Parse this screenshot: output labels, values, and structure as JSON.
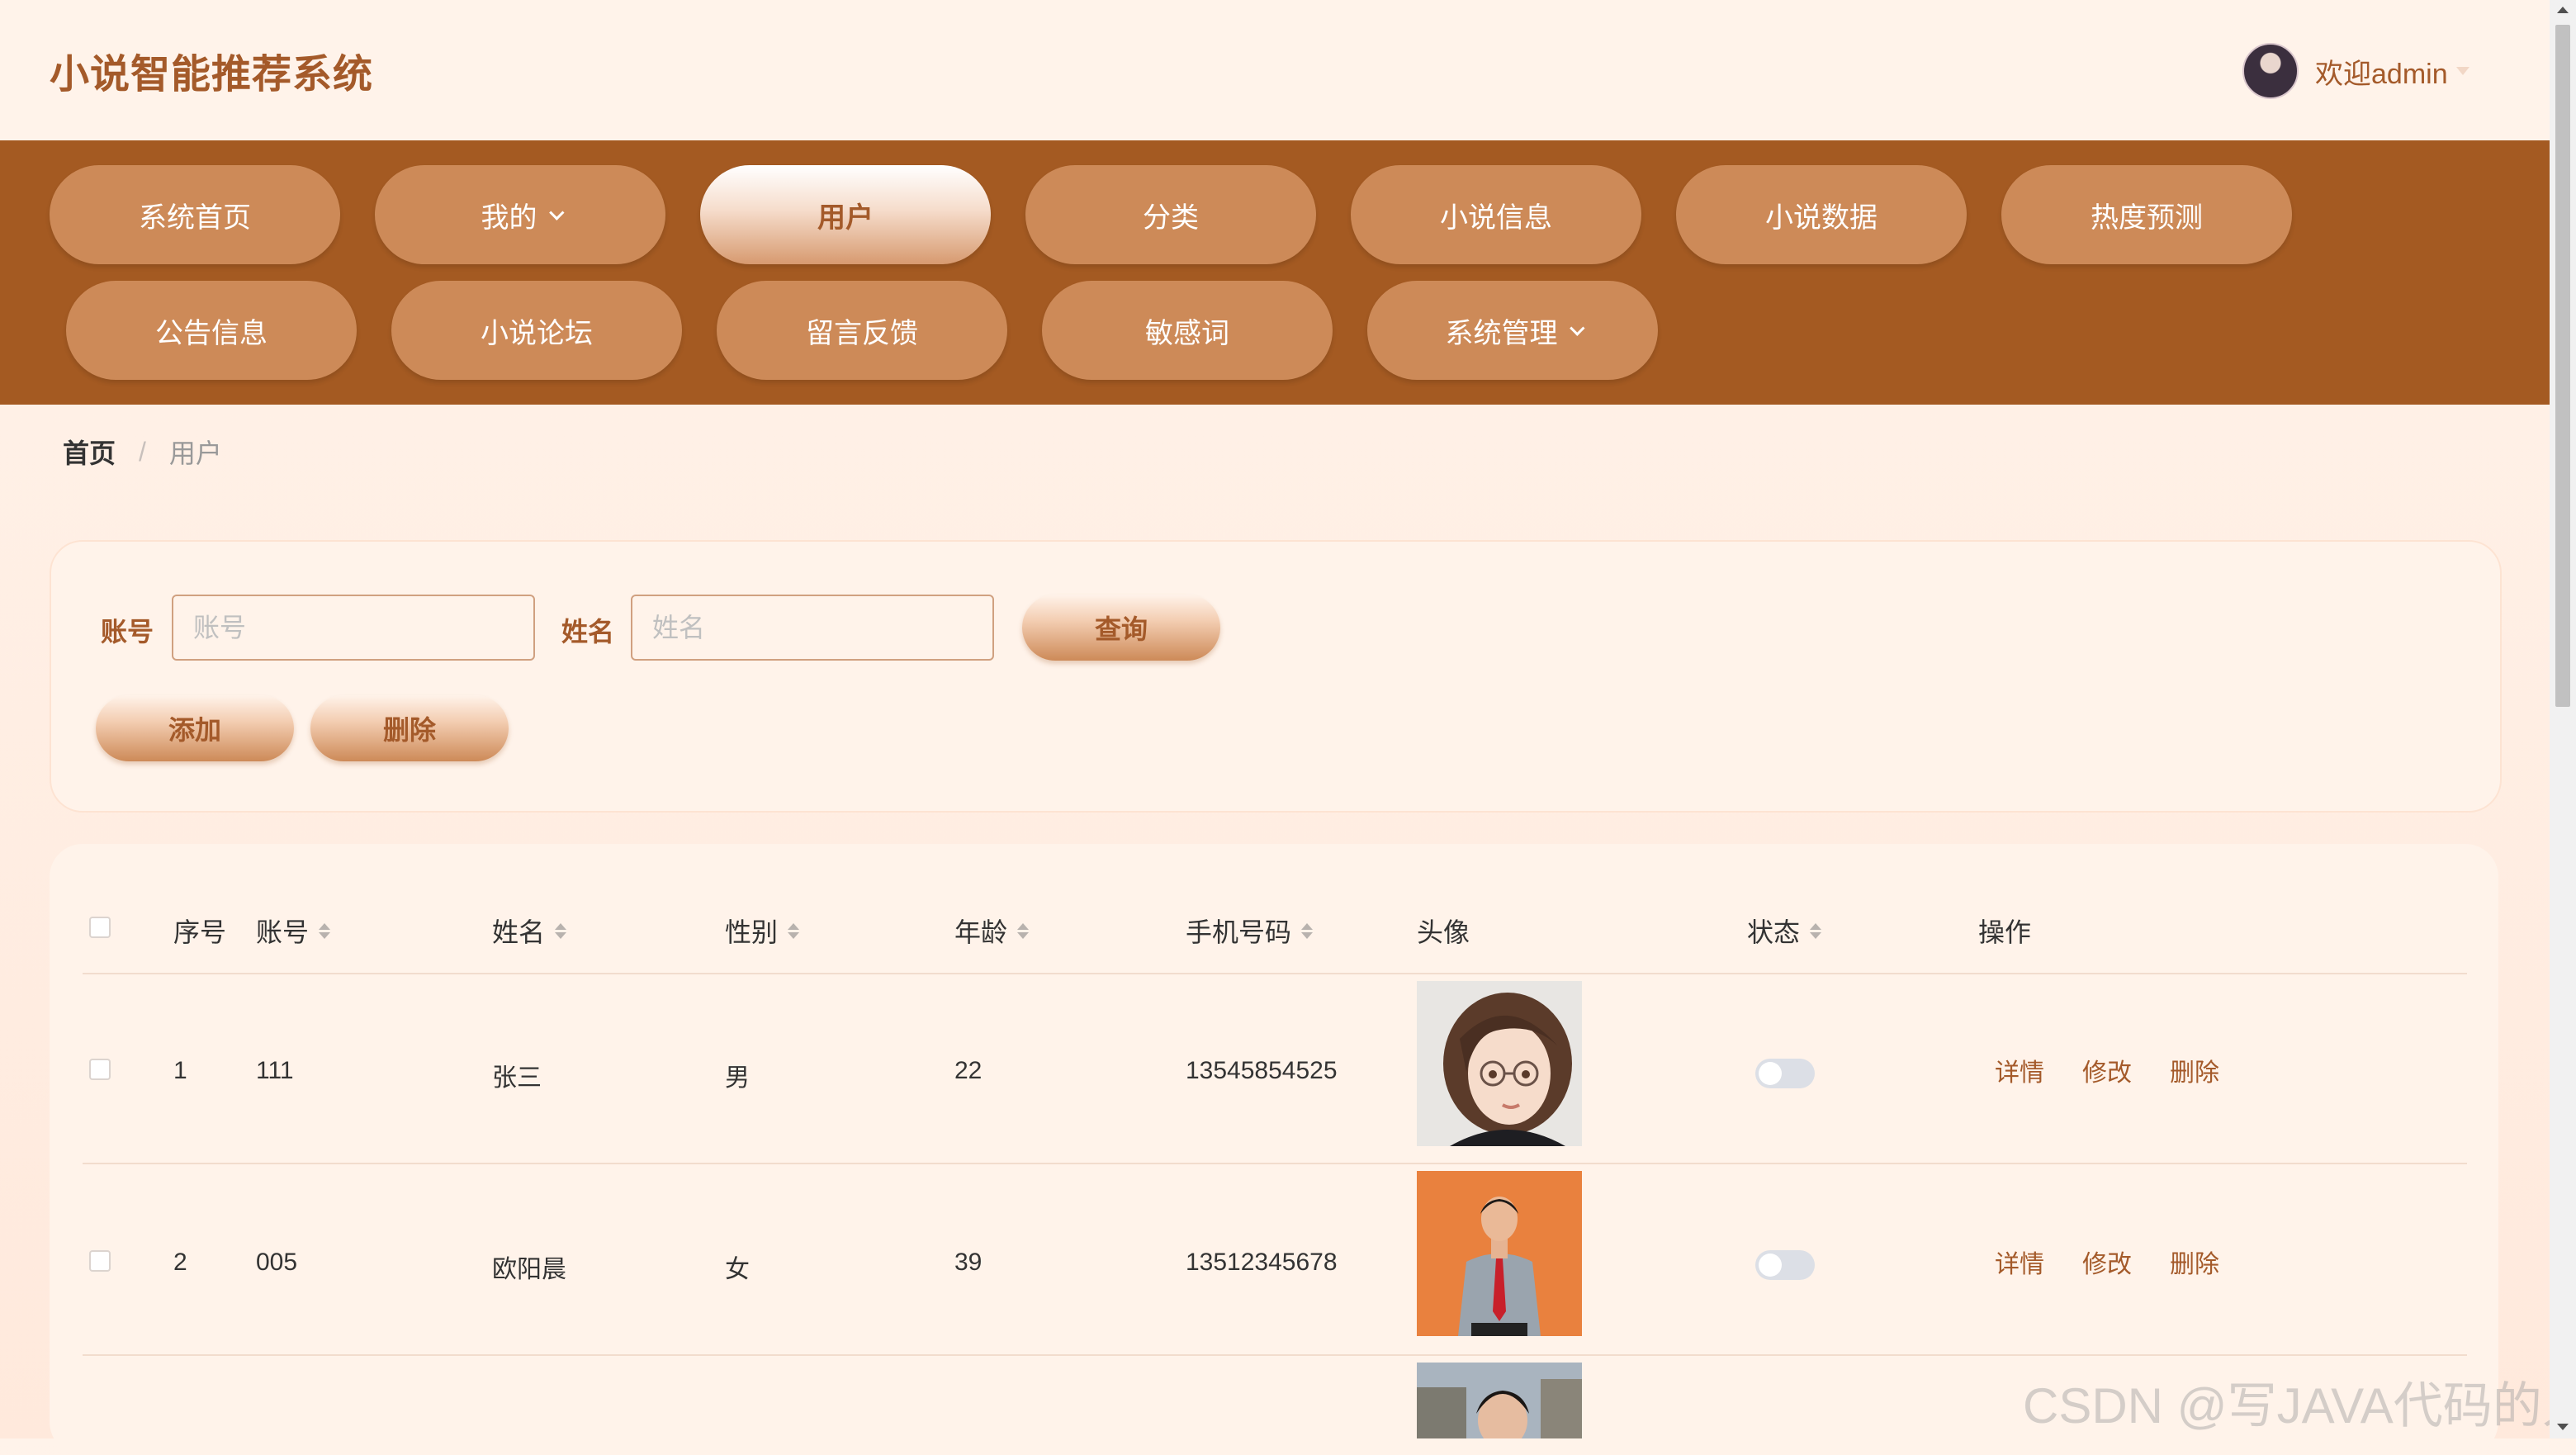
{
  "header": {
    "app_title": "小说智能推荐系统",
    "welcome_text": "欢迎admin"
  },
  "nav": {
    "row1": [
      "系统首页",
      "我的",
      "用户",
      "分类",
      "小说信息",
      "小说数据",
      "热度预测"
    ],
    "row2": [
      "公告信息",
      "小说论坛",
      "留言反馈",
      "敏感词",
      "系统管理"
    ],
    "active": "用户"
  },
  "breadcrumb": {
    "home": "首页",
    "separator": "/",
    "current": "用户"
  },
  "search": {
    "account_label": "账号",
    "account_placeholder": "账号",
    "name_label": "姓名",
    "name_placeholder": "姓名",
    "query_button": "查询",
    "add_button": "添加",
    "delete_button": "删除"
  },
  "table": {
    "headers": {
      "index": "序号",
      "account": "账号",
      "name": "姓名",
      "gender": "性别",
      "age": "年龄",
      "phone": "手机号码",
      "avatar": "头像",
      "status": "状态",
      "actions": "操作"
    },
    "rows": [
      {
        "index": "1",
        "account": "111",
        "name": "张三",
        "gender": "男",
        "age": "22",
        "phone": "13545854525",
        "avatar_desc": "illustrated woman with glasses",
        "status_on": false
      },
      {
        "index": "2",
        "account": "005",
        "name": "欧阳晨",
        "gender": "女",
        "age": "39",
        "phone": "13512345678",
        "avatar_desc": "man in red tie on orange background",
        "status_on": false
      }
    ],
    "actions": {
      "detail": "详情",
      "edit": "修改",
      "delete": "删除"
    }
  },
  "watermark": "CSDN @写JAVA代码的人",
  "colors": {
    "brand": "#a45a22",
    "nav_button": "#cd8a58",
    "accent_text": "#a45a2a",
    "background": "#fff3ea"
  }
}
